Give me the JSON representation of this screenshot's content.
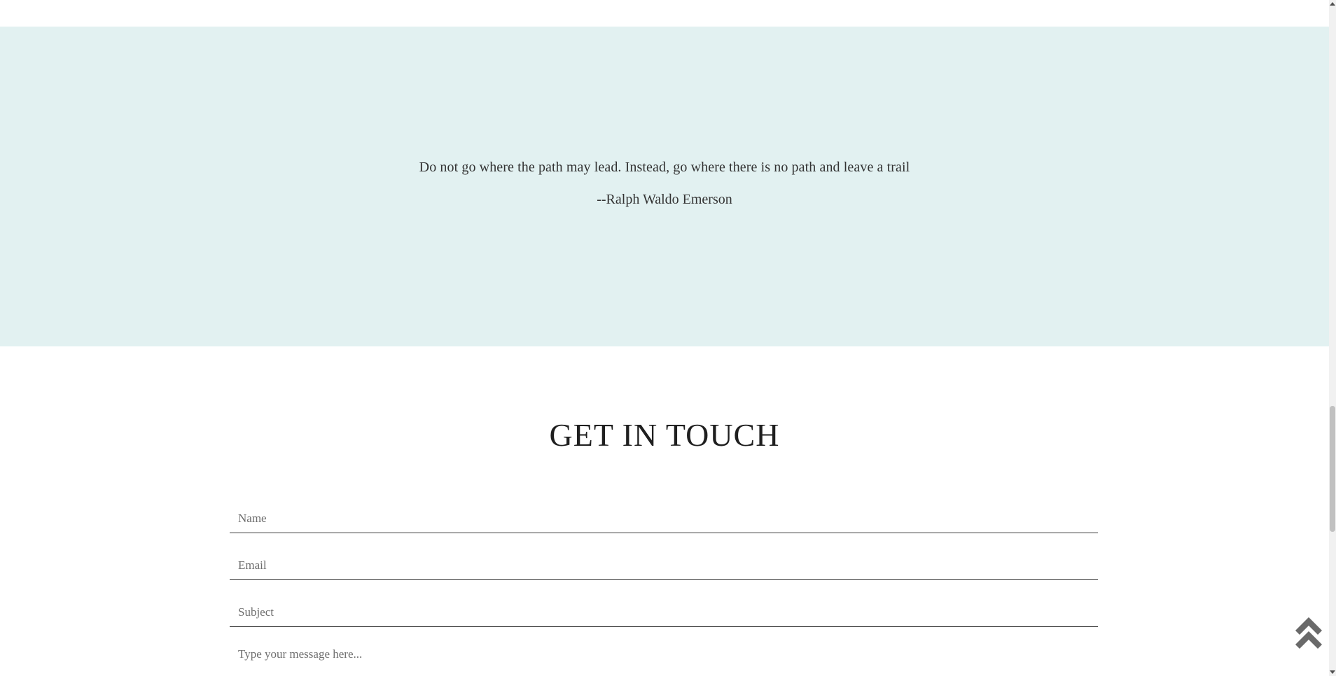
{
  "quote": {
    "text": "Do not go where the path may lead. Instead, go where there is no path and leave a trail",
    "author": "--Ralph Waldo Emerson"
  },
  "contact": {
    "title": "GET IN TOUCH",
    "name_placeholder": "Name",
    "email_placeholder": "Email",
    "subject_placeholder": "Subject",
    "message_placeholder": "Type your message here..."
  },
  "icons": {
    "back_to_top": "double-chevron-up-icon"
  },
  "colors": {
    "quote_background": "#e2f1f1",
    "text": "#333333",
    "icon": "#6a6a6a"
  }
}
